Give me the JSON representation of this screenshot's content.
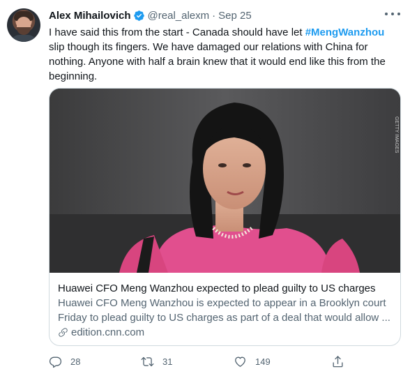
{
  "author": {
    "name": "Alex Mihailovich",
    "handle": "@real_alexm",
    "separator": "·",
    "date": "Sep 25",
    "verified": true,
    "avatar_icon": "profile-photo"
  },
  "tweet": {
    "line1_before": "I have said this from the start - Canada should have let ",
    "hashtag": "#MengWanzhou",
    "line2": "slip though its fingers. We have damaged our relations with China for",
    "line3": "nothing. Anyone with half a brain knew that it would end like this from the",
    "line4": "beginning."
  },
  "card": {
    "title": "Huawei CFO Meng Wanzhou expected to plead guilty to US charges",
    "description_line1": "Huawei CFO Meng Wanzhou is expected to appear in a Brooklyn court",
    "description_line2": "Friday to plead guilty to US charges as part of a deal that would allow ...",
    "domain": "edition.cnn.com",
    "image_caption": "Photo of woman in pink jacket with pearl necklace"
  },
  "actions": {
    "reply_count": "28",
    "retweet_count": "31",
    "like_count": "149"
  },
  "colors": {
    "accent": "#1d9bf0",
    "text": "#0f1419",
    "muted": "#536471",
    "border": "#cfd9de"
  }
}
